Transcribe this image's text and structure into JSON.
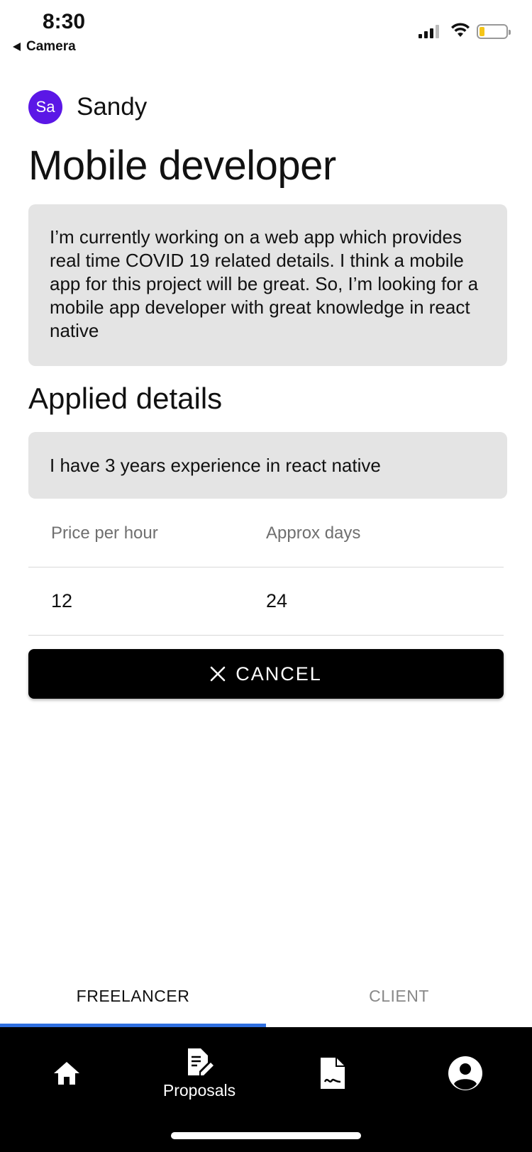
{
  "status_bar": {
    "time": "8:30",
    "back_app": "Camera"
  },
  "user": {
    "initials": "Sa",
    "name": "Sandy",
    "avatar_color": "#5b17e6"
  },
  "job": {
    "title": "Mobile developer",
    "description": "I’m currently working on a web app which provides real time COVID 19 related details. I think a mobile app for this project will be great. So, I’m looking for a mobile app developer with great knowledge in react native"
  },
  "applied": {
    "section_title": "Applied details",
    "message": "I have 3 years experience in react native",
    "table": {
      "headers": [
        "Price per hour",
        "Approx days"
      ],
      "values": [
        "12",
        "24"
      ]
    }
  },
  "cancel_button": {
    "label": "CANCEL",
    "icon": "close-icon"
  },
  "role_tabs": [
    {
      "label": "FREELANCER",
      "active": true
    },
    {
      "label": "CLIENT",
      "active": false
    }
  ],
  "accent_color": "#2f6fe0",
  "bottom_nav": [
    {
      "icon": "home-icon",
      "label": ""
    },
    {
      "icon": "proposal-icon",
      "label": "Proposals"
    },
    {
      "icon": "contract-icon",
      "label": ""
    },
    {
      "icon": "account-icon",
      "label": ""
    }
  ]
}
